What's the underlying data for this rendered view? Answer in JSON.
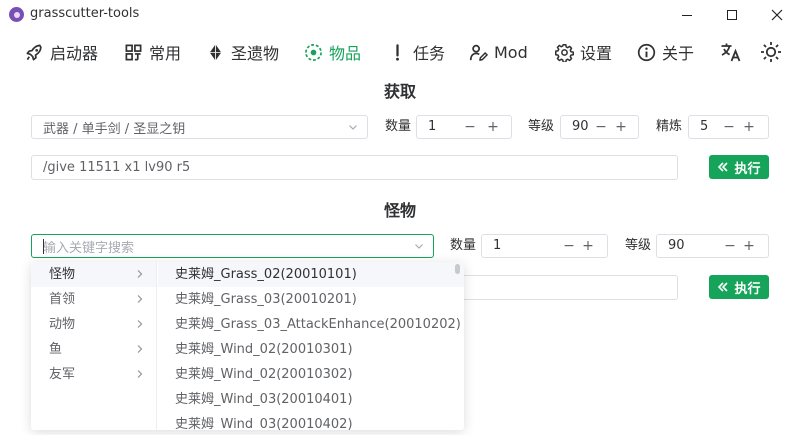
{
  "window": {
    "title": "grasscutter-tools"
  },
  "nav": {
    "items": [
      {
        "label": "启动器",
        "icon": "rocket-icon"
      },
      {
        "label": "常用",
        "icon": "grid-icon"
      },
      {
        "label": "圣遗物",
        "icon": "diamond-icon"
      },
      {
        "label": "物品",
        "icon": "target-icon",
        "active": true
      },
      {
        "label": "任务",
        "icon": "exclamation-icon"
      },
      {
        "label": "Mod",
        "icon": "pen-user-icon"
      },
      {
        "label": "设置",
        "icon": "gear-icon"
      },
      {
        "label": "关于",
        "icon": "info-icon"
      }
    ]
  },
  "colors": {
    "accent": "#16a35a",
    "border": "#dcdfe6",
    "text": "#303133"
  },
  "obtain": {
    "title": "获取",
    "item_select": "武器 / 单手剑 / 圣显之钥",
    "quantity_label": "数量",
    "quantity_value": "1",
    "level_label": "等级",
    "level_value": "90",
    "refine_label": "精炼",
    "refine_value": "5",
    "command": "/give 11511 x1 lv90 r5",
    "execute_label": "执行"
  },
  "monster": {
    "title": "怪物",
    "search_placeholder": "输入关键字搜索",
    "quantity_label": "数量",
    "quantity_value": "1",
    "level_label": "等级",
    "level_value": "90",
    "execute_label": "执行"
  },
  "dropdown": {
    "categories": [
      "怪物",
      "首领",
      "动物",
      "鱼",
      "友军"
    ],
    "options": [
      "史莱姆_Grass_02(20010101)",
      "史莱姆_Grass_03(20010201)",
      "史莱姆_Grass_03_AttackEnhance(20010202)",
      "史莱姆_Wind_02(20010301)",
      "史莱姆_Wind_02(20010302)",
      "史莱姆_Wind_03(20010401)",
      "史莱姆_Wind_03(20010402)"
    ]
  }
}
